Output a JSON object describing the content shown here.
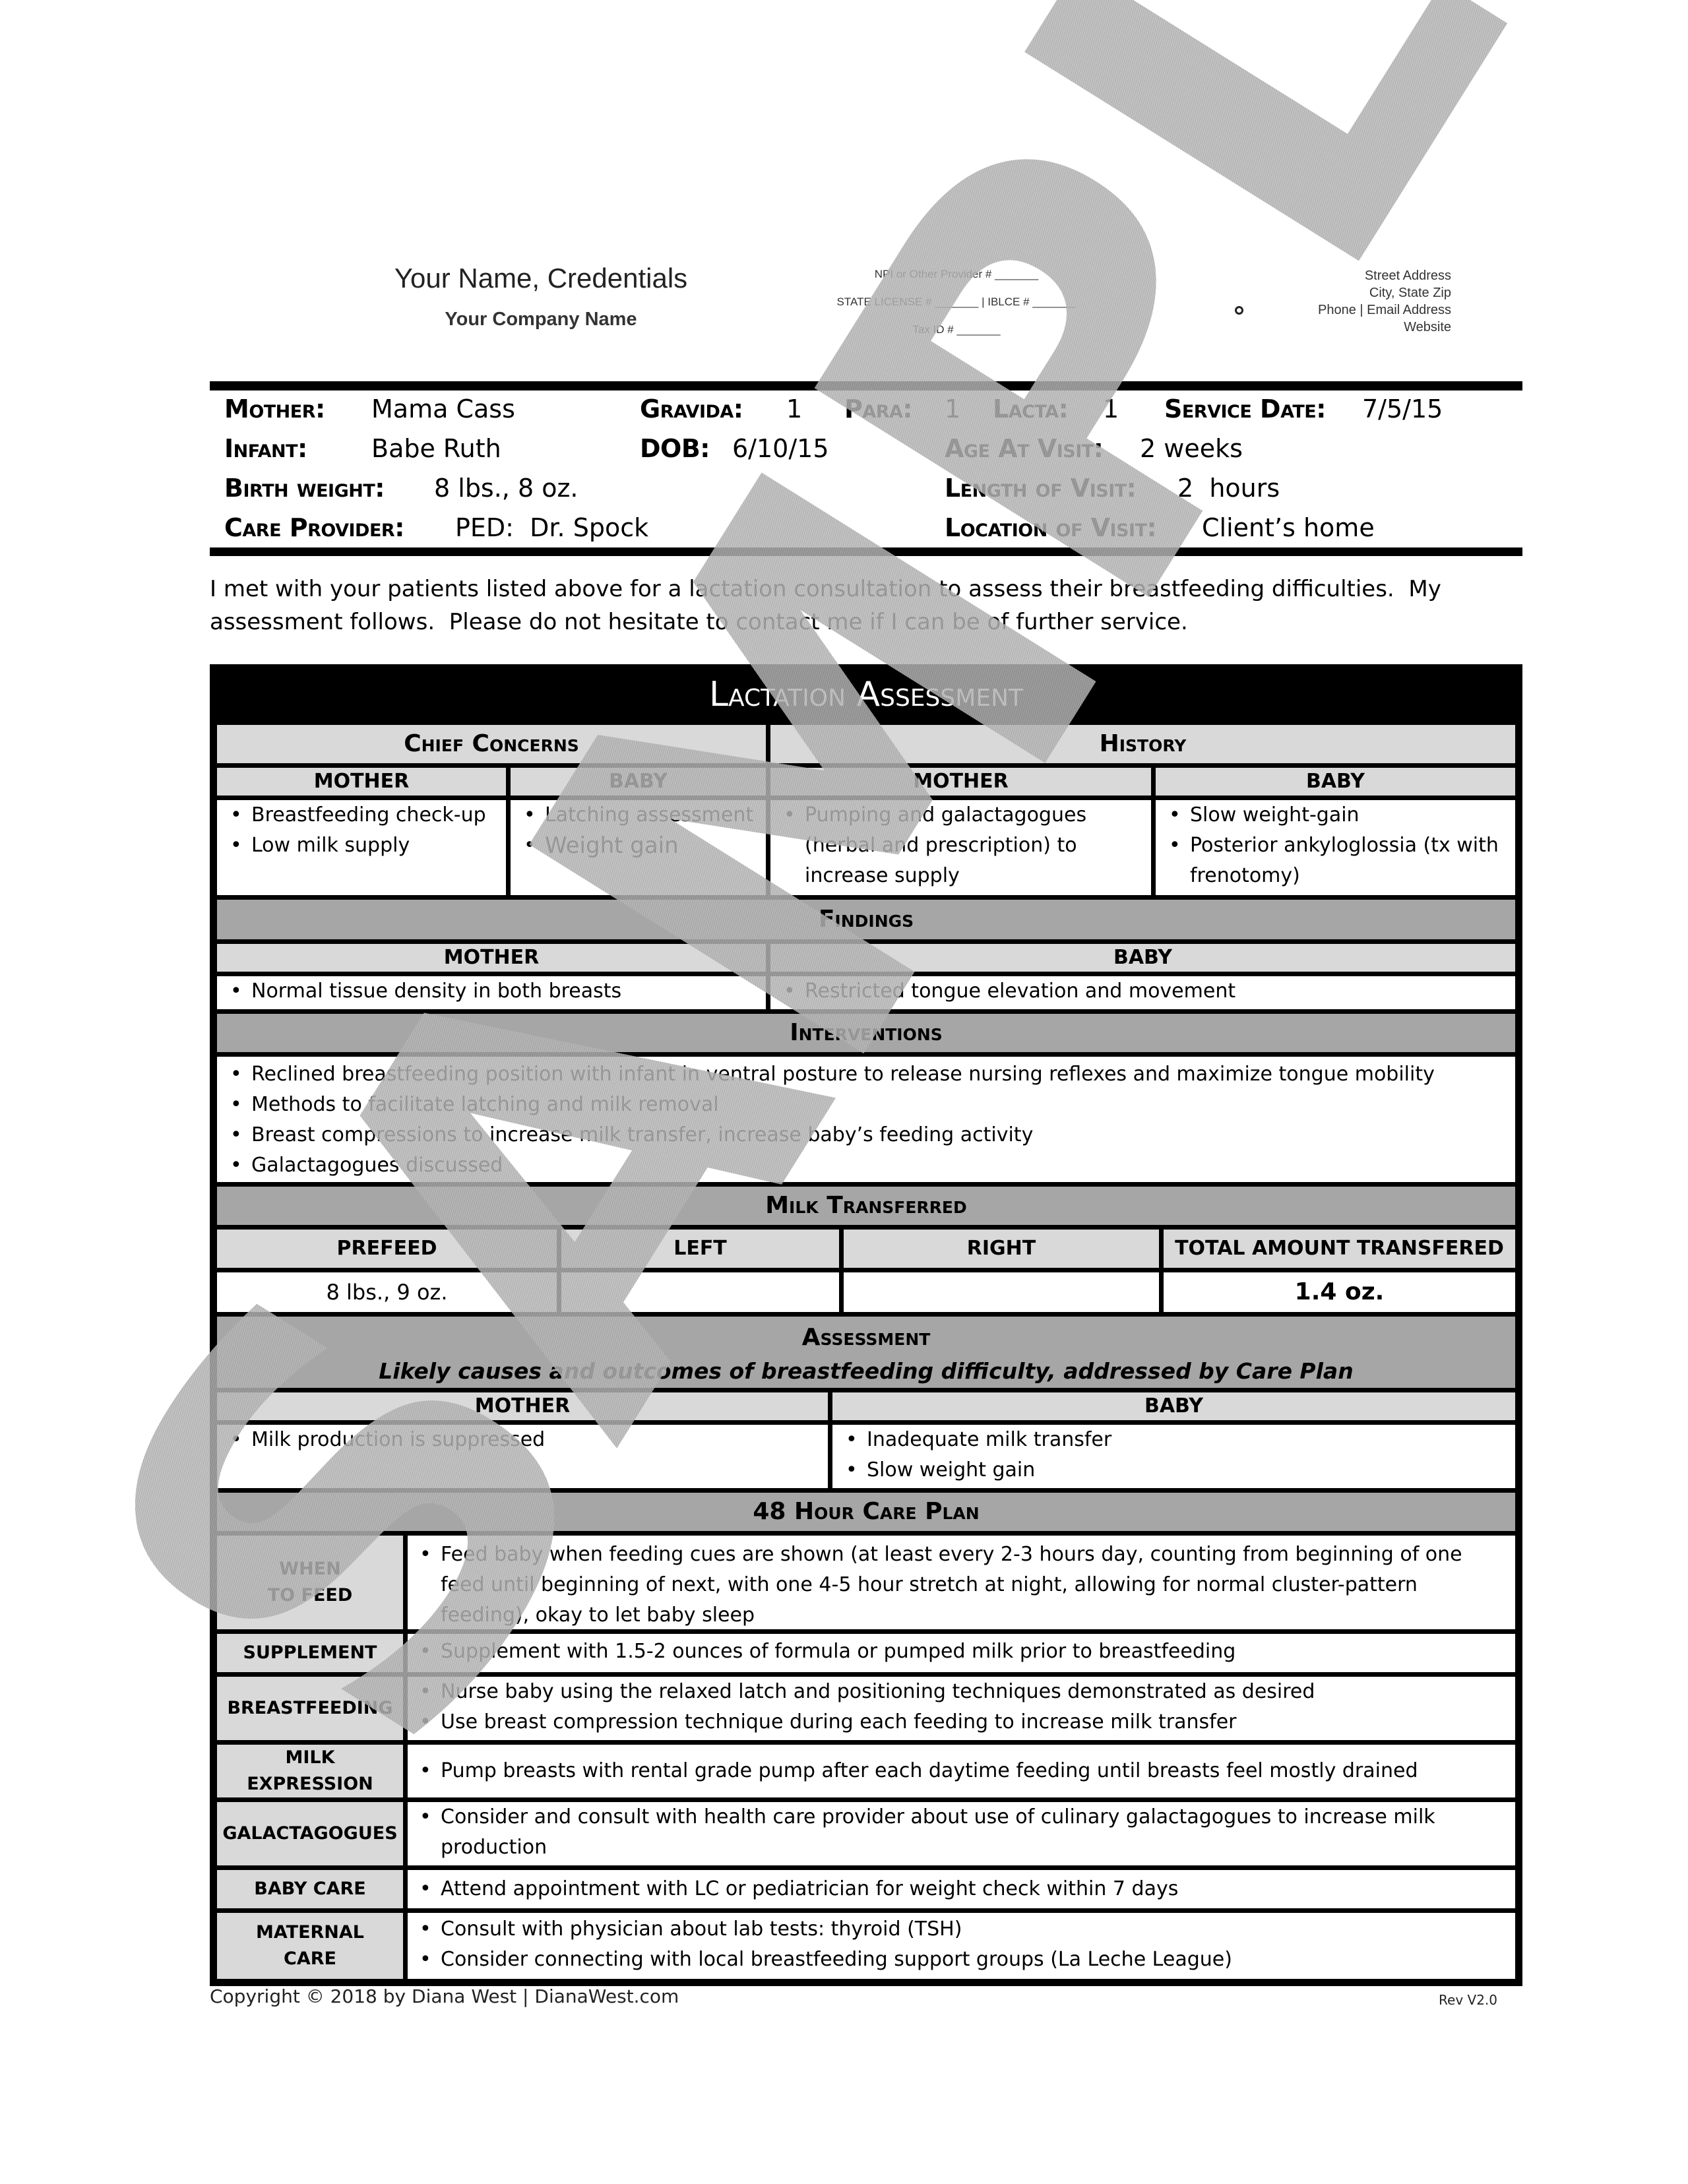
{
  "letterhead": {
    "name": "Your Name, Credentials",
    "company": "Your Company Name",
    "ids": [
      "NPI or Other Provider # _______",
      "STATE LICENSE # _______  |  IBLCE # _______",
      "Tax ID # _______"
    ],
    "address": [
      "Street Address",
      "City, State Zip",
      "Phone | Email Address",
      "Website"
    ]
  },
  "patient": {
    "mother_label": "Mother:",
    "mother": "Mama Cass",
    "gravida_label": "Gravida:",
    "gravida": "1",
    "para_label": "Para:",
    "para": "1",
    "lacta_label": "Lacta:",
    "lacta": "1",
    "service_date_label": "Service Date:",
    "service_date": "7/5/15",
    "infant_label": "Infant:",
    "infant": "Babe Ruth",
    "dob_label": "DOB:",
    "dob": "6/10/15",
    "age_label": "Age At Visit:",
    "age": "2 weeks",
    "birth_weight_label": "Birth weight:",
    "birth_weight": "8 lbs., 8 oz.",
    "length_label": "Length of Visit:",
    "length": "2  hours",
    "care_provider_label": "Care Provider:",
    "care_provider": "PED:  Dr. Spock",
    "location_label": "Location of Visit:",
    "location": "Client’s home"
  },
  "intro": "I met with your patients listed above for a lactation consultation to assess their breastfeeding difficulties.  My assessment follows.  Please do not hesitate to contact me if I can be of further service.",
  "assessment": {
    "title": "Lactation Assessment",
    "chief_concerns": {
      "title": "Chief Concerns",
      "mother_label": "MOTHER",
      "baby_label": "BABY",
      "mother": [
        "Breastfeeding check-up",
        "Low milk supply"
      ],
      "baby": [
        "Latching assessment",
        "Weight gain"
      ]
    },
    "history": {
      "title": "History",
      "mother_label": "MOTHER",
      "baby_label": "BABY",
      "mother": [
        "Pumping and galactagogues (herbal and prescription) to increase supply"
      ],
      "baby": [
        "Slow weight-gain",
        "Posterior ankyloglossia (tx with frenotomy)"
      ]
    },
    "findings": {
      "title": "Findings",
      "mother_label": "MOTHER",
      "baby_label": "BABY",
      "mother": [
        "Normal tissue density in both breasts"
      ],
      "baby": [
        "Restricted tongue elevation and movement"
      ]
    },
    "interventions": {
      "title": "Interventions",
      "items": [
        "Reclined breastfeeding position with infant in ventral posture to release nursing reflexes and maximize tongue mobility",
        "Methods to facilitate latching and milk removal",
        "Breast compressions to increase milk transfer, increase baby’s feeding activity",
        "Galactagogues discussed"
      ]
    },
    "milk_transferred": {
      "title": "Milk Transferred",
      "headers": [
        "PREFEED",
        "LEFT",
        "RIGHT",
        "TOTAL AMOUNT TRANSFERED"
      ],
      "values": [
        "8 lbs., 9 oz.",
        "",
        "",
        "1.4 oz."
      ]
    },
    "assessment_section": {
      "title": "Assessment",
      "subtitle": "Likely causes and outcomes of breastfeeding difficulty, addressed by Care Plan",
      "mother_label": "MOTHER",
      "baby_label": "BABY",
      "mother": [
        "Milk production is suppressed"
      ],
      "baby": [
        "Inadequate milk transfer",
        "Slow weight gain"
      ]
    },
    "care_plan": {
      "title": "48 Hour Care Plan",
      "rows": [
        {
          "label": "WHEN\nTO FEED",
          "items": [
            "Feed baby when feeding cues are shown (at least every 2-3 hours day, counting from beginning of one feed until beginning of next, with one 4-5 hour stretch at night, allowing for normal cluster-pattern feeding), okay to let baby sleep"
          ]
        },
        {
          "label": "SUPPLEMENT",
          "items": [
            "Supplement with 1.5-2 ounces of formula or pumped milk prior to breastfeeding"
          ]
        },
        {
          "label": "BREASTFEEDING",
          "items": [
            "Nurse baby using the relaxed latch and positioning techniques demonstrated as desired",
            "Use breast compression technique during each feeding to increase milk transfer"
          ]
        },
        {
          "label": "MILK\nEXPRESSION",
          "items": [
            "Pump breasts with rental grade pump after each daytime feeding until breasts feel mostly drained"
          ]
        },
        {
          "label": "GALACTAGOGUES",
          "items": [
            "Consider and consult with health care provider about use of culinary galactagogues to increase milk production"
          ]
        },
        {
          "label": "BABY CARE",
          "items": [
            "Attend appointment with LC or pediatrician  for weight check within 7 days"
          ]
        },
        {
          "label": "MATERNAL\nCARE",
          "items": [
            "Consult with physician about lab tests:  thyroid (TSH)",
            "Consider connecting with local breastfeeding support groups (La Leche League)"
          ]
        }
      ]
    }
  },
  "watermark": "SAMPLE",
  "footer": {
    "copyright": "Copyright © 2018 by Diana West | DianaWest.com",
    "revision": "Rev V2.0"
  }
}
